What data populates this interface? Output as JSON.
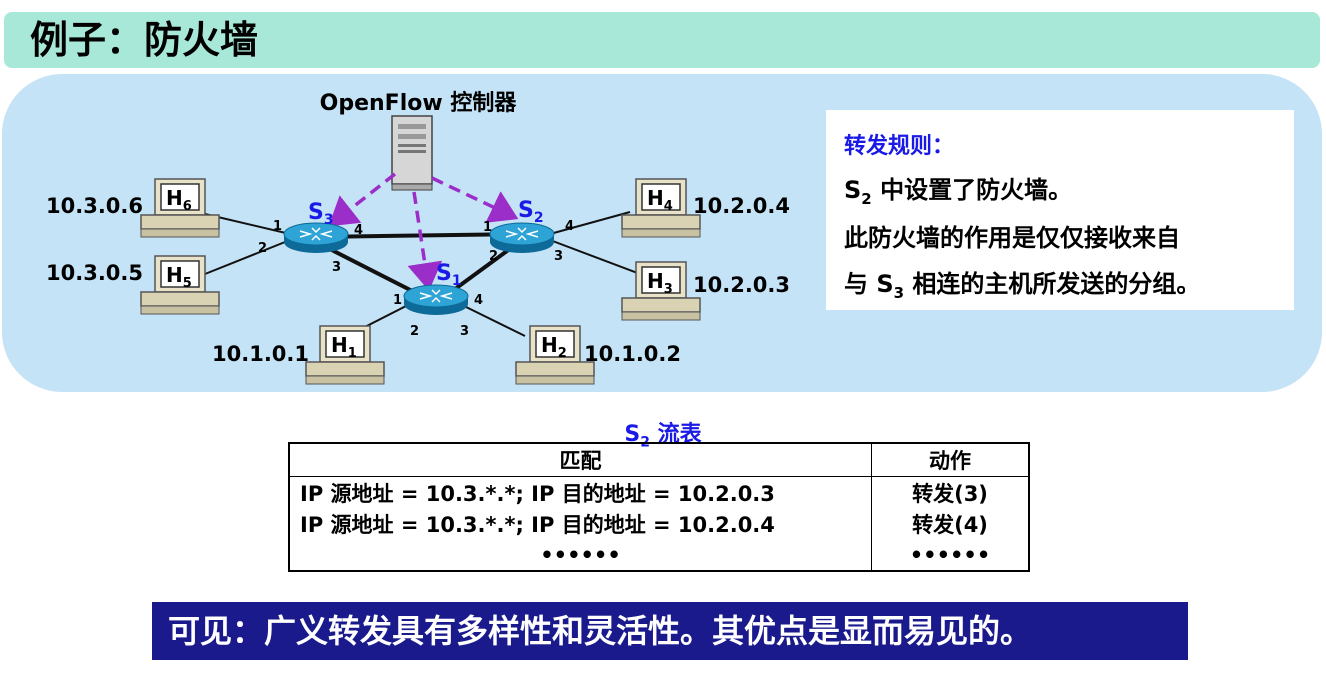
{
  "title": "例子：防火墙",
  "diagram": {
    "controller_label": "OpenFlow 控制器",
    "switches": [
      {
        "id": "s1",
        "label": "S",
        "sub": "1"
      },
      {
        "id": "s2",
        "label": "S",
        "sub": "2"
      },
      {
        "id": "s3",
        "label": "S",
        "sub": "3"
      }
    ],
    "hosts": [
      {
        "id": "h1",
        "label": "H",
        "sub": "1",
        "ip": "10.1.0.1"
      },
      {
        "id": "h2",
        "label": "H",
        "sub": "2",
        "ip": "10.1.0.2"
      },
      {
        "id": "h3",
        "label": "H",
        "sub": "3",
        "ip": "10.2.0.3"
      },
      {
        "id": "h4",
        "label": "H",
        "sub": "4",
        "ip": "10.2.0.4"
      },
      {
        "id": "h5",
        "label": "H",
        "sub": "5",
        "ip": "10.3.0.5"
      },
      {
        "id": "h6",
        "label": "H",
        "sub": "6",
        "ip": "10.3.0.6"
      }
    ],
    "port_labels": {
      "s3_p1": "1",
      "s3_p2": "2",
      "s3_p3": "3",
      "s3_p4": "4",
      "s2_p1": "1",
      "s2_p2": "2",
      "s2_p3": "3",
      "s2_p4": "4",
      "s1_p1": "1",
      "s1_p2": "2",
      "s1_p3": "3",
      "s1_p4": "4"
    },
    "colors": {
      "control_link": "#9b2ec9",
      "switch": "#1c8fc4",
      "label_blue": "#1a1ae6"
    }
  },
  "rules": {
    "title": "转发规则：",
    "line1_prefix": "S",
    "line1_sub": "2",
    "line1_rest": " 中设置了防火墙。",
    "line2": "此防火墙的作用是仅仅接收来自",
    "line3_prefix": "与 S",
    "line3_sub": "3",
    "line3_rest": " 相连的主机所发送的分组。"
  },
  "flow_table": {
    "caption_prefix": "S",
    "caption_sub": "2",
    "caption_rest": " 流表",
    "headers": [
      "匹配",
      "动作"
    ],
    "rows": [
      {
        "match": "IP 源地址 = 10.3.*.*;  IP 目的地址 = 10.2.0.3",
        "action": "转发(3)"
      },
      {
        "match": "IP 源地址 = 10.3.*.*;  IP 目的地址 = 10.2.0.4",
        "action": "转发(4)"
      },
      {
        "match": "••••••",
        "action": "••••••"
      }
    ]
  },
  "conclusion": "可见：广义转发具有多样性和灵活性。其优点是显而易见的。"
}
